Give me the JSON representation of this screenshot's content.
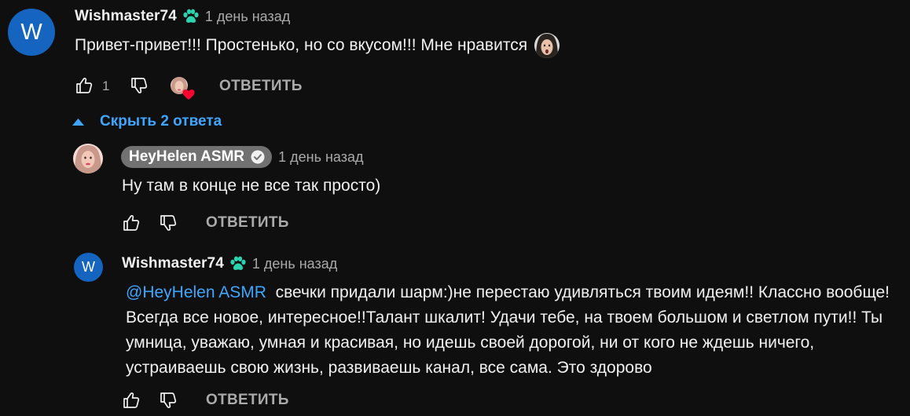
{
  "comment": {
    "avatar_letter": "W",
    "author": "Wishmaster74",
    "time": "1 день назад",
    "text": "Привет-привет!!! Простенько, но со вкусом!!! Мне нравится",
    "like_count": "1",
    "reply_label": "ОТВЕТИТЬ"
  },
  "replies_toggle": {
    "label": "Скрыть 2 ответа"
  },
  "replies": [
    {
      "author": "HeyHelen ASMR",
      "time": "1 день назад",
      "text": "Ну там в конце не все так просто)",
      "reply_label": "ОТВЕТИТЬ"
    },
    {
      "avatar_letter": "W",
      "author": "Wishmaster74",
      "time": "1 день назад",
      "mention": "@HeyHelen ASMR",
      "text": "свечки придали шарм:)не перестаю удивляться твоим идеям!! Классно вообще! Всегда все новое, интересное!!Талант шкалит! Удачи тебе, на твоем большом и светлом пути!! Ты умница, уважаю, умная и красивая, но идешь своей дорогой, ни от кого не ждешь ничего, устраиваешь свою жизнь, развиваешь канал, все сама. Это здорово",
      "reply_label": "ОТВЕТИТЬ"
    }
  ],
  "colors": {
    "background": "#0f0f0f",
    "text": "#f1f1f1",
    "secondary": "#aaaaaa",
    "link": "#3ea6ff",
    "avatar": "#1565c0",
    "member_badge": "#2bd4b0",
    "heart": "#ff0033"
  }
}
